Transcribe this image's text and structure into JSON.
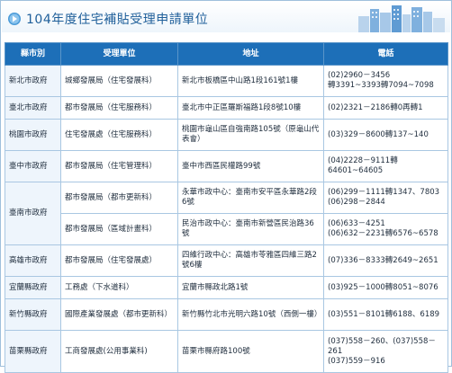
{
  "title": "104年度住宅補貼受理申請單位",
  "icons": {
    "title": "arrow-bullet-icon",
    "skyline": "city-skyline-icon"
  },
  "colors": {
    "header_bg": "#1d6fb8",
    "title_text": "#1f5f9a",
    "border": "#a9c7e2"
  },
  "columns": [
    "縣市別",
    "受理單位",
    "地址",
    "電話"
  ],
  "rows": [
    {
      "city": "新北市政府",
      "unit": "城鄉發展局（住宅發展科）",
      "address": "新北市板橋區中山路1段161號1樓",
      "phone": "(02)2960－3456\n轉3391~3393轉7094~7098"
    },
    {
      "city": "臺北市政府",
      "unit": "都市發展局（住宅服務科）",
      "address": "臺北市中正區羅斯福路1段8號10樓",
      "phone": "(02)2321－2186轉0再轉1"
    },
    {
      "city": "桃園市政府",
      "unit": "住宅發展處（住宅服務科）",
      "address": "桃園市龜山區自強南路105號（原龜山代表會）",
      "phone": "(03)329－8600轉137~140"
    },
    {
      "city": "臺中市政府",
      "unit": "都市發展局（住宅管理科）",
      "address": "臺中市西區民權路99號",
      "phone": "(04)2228－9111轉\n64601~64605"
    },
    {
      "city": "臺南市政府",
      "unit": "都市發展局（都市更新科）",
      "address": "永華市政中心：臺南市安平區永華路2段6號",
      "phone": "(06)299－1111轉1347、7803\n(06)298－2844"
    },
    {
      "city": "",
      "unit": "都市發展局（區域計畫科）",
      "address": "民治市政中心：臺南市新營區民治路36號",
      "phone": "(06)633－4251\n(06)632－2231轉6576~6578"
    },
    {
      "city": "高雄市政府",
      "unit": "都市發展局（住宅發展處）",
      "address": "四維行政中心：高雄市苓雅區四維三路2號6樓",
      "phone": "(07)336－8333轉2649~2651"
    },
    {
      "city": "宜蘭縣政府",
      "unit": "工務處（下水道科）",
      "address": "宜蘭市縣政北路1號",
      "phone": "(03)925－1000轉8051~8076"
    },
    {
      "city": "新竹縣政府",
      "unit": "國際產業發展處（都市更新科）",
      "address": "新竹縣竹北市光明六路10號（西側一樓）",
      "phone": "(03)551－8101轉6188、6189"
    },
    {
      "city": "苗栗縣政府",
      "unit": "工商發展處(公用事業科)",
      "address": "苗栗市縣府路100號",
      "phone": "(037)558－260、(037)558－261\n(037)559－916"
    }
  ]
}
